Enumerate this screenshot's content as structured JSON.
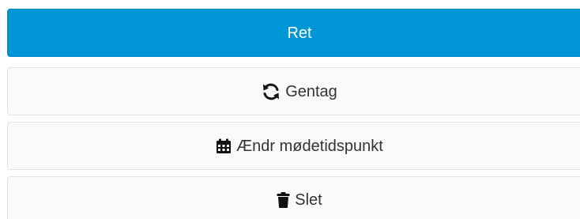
{
  "actions": {
    "primary_label": "Ret",
    "repeat_label": "Gentag",
    "change_time_label": "Ændr mødetidspunkt",
    "delete_label": "Slet"
  },
  "icons": {
    "repeat": "refresh-icon",
    "change_time": "calendar-icon",
    "delete": "trash-icon"
  },
  "colors": {
    "primary": "#0096d6",
    "default_bg": "#fafafa",
    "default_border": "#e1e1e1",
    "text_dark": "#333333"
  }
}
